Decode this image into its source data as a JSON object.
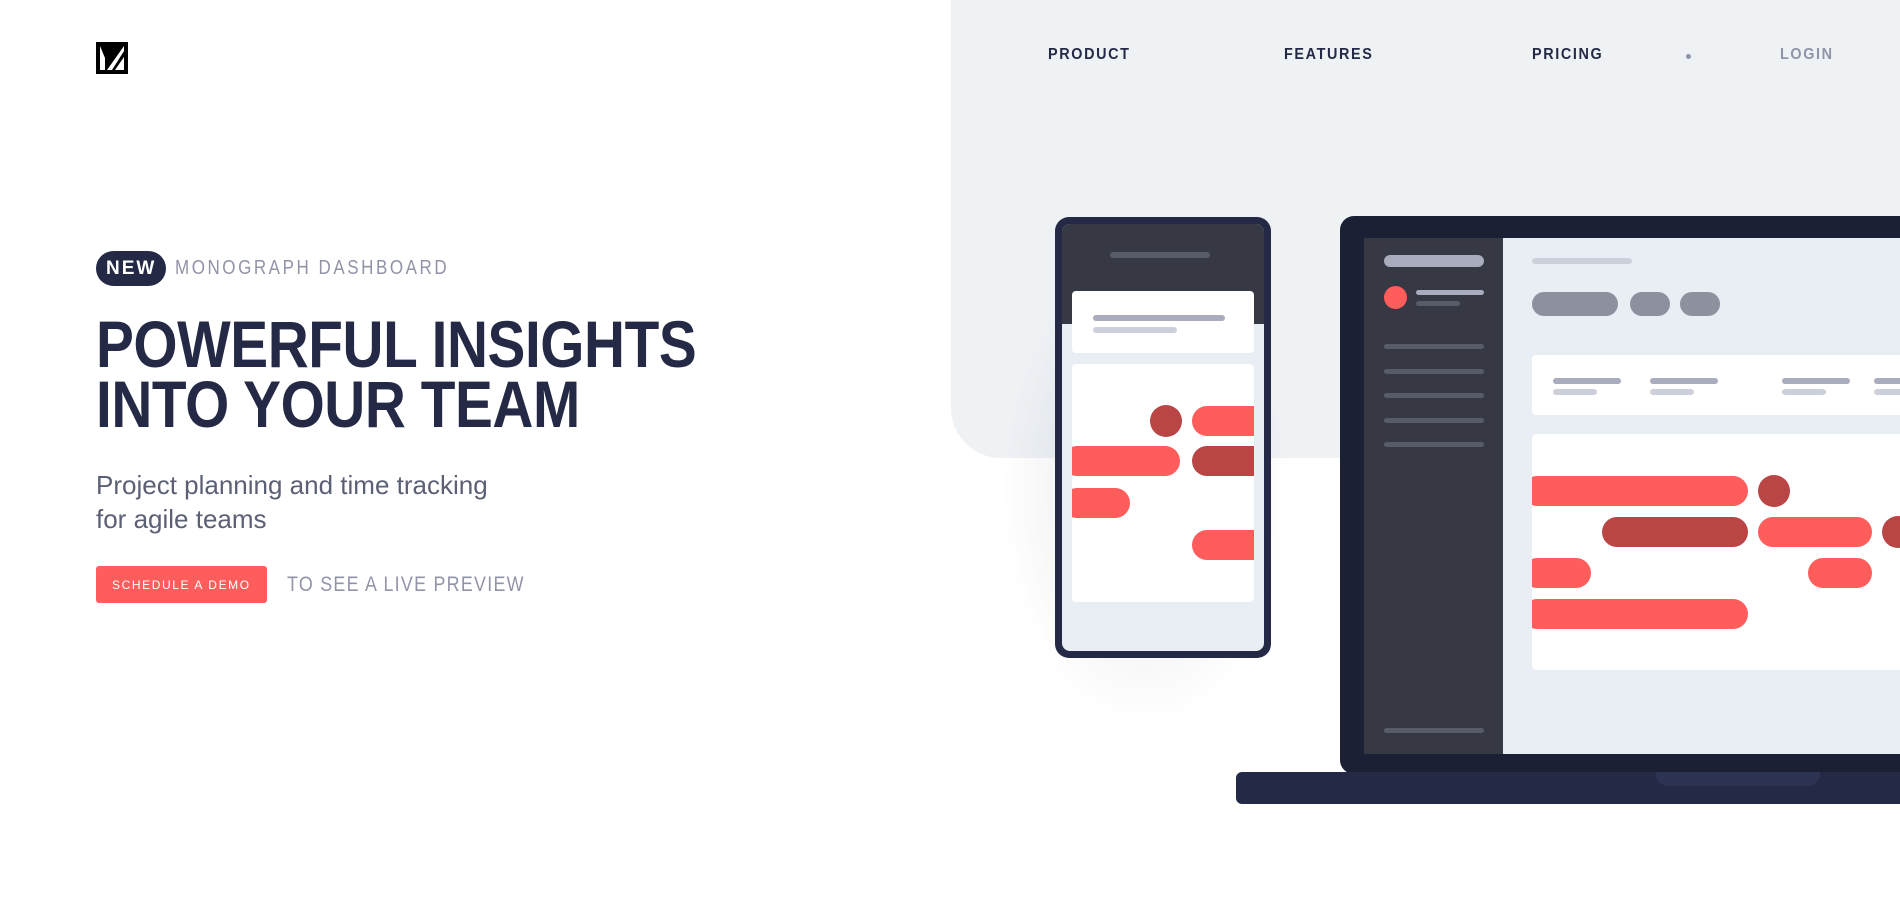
{
  "brand": {
    "logo_icon": "monograph-logo-icon"
  },
  "nav": {
    "items": [
      {
        "label": "PRODUCT"
      },
      {
        "label": "FEATURES"
      },
      {
        "label": "PRICING"
      },
      {
        "label": "LOGIN"
      }
    ]
  },
  "hero": {
    "badge": "NEW",
    "badge_text": "MONOGRAPH DASHBOARD",
    "headline": "POWERFUL INSIGHTS INTO YOUR TEAM",
    "subtext_line1": "Project planning and time tracking",
    "subtext_line2": "for agile teams",
    "cta_label": "SCHEDULE A DEMO",
    "cta_note": "TO SEE A LIVE PREVIEW"
  },
  "colors": {
    "navy": "#242a45",
    "gray": "#9194a8",
    "accent": "#ff5c5c",
    "accent_dark": "#b94545",
    "panel": "#eef2f5"
  }
}
